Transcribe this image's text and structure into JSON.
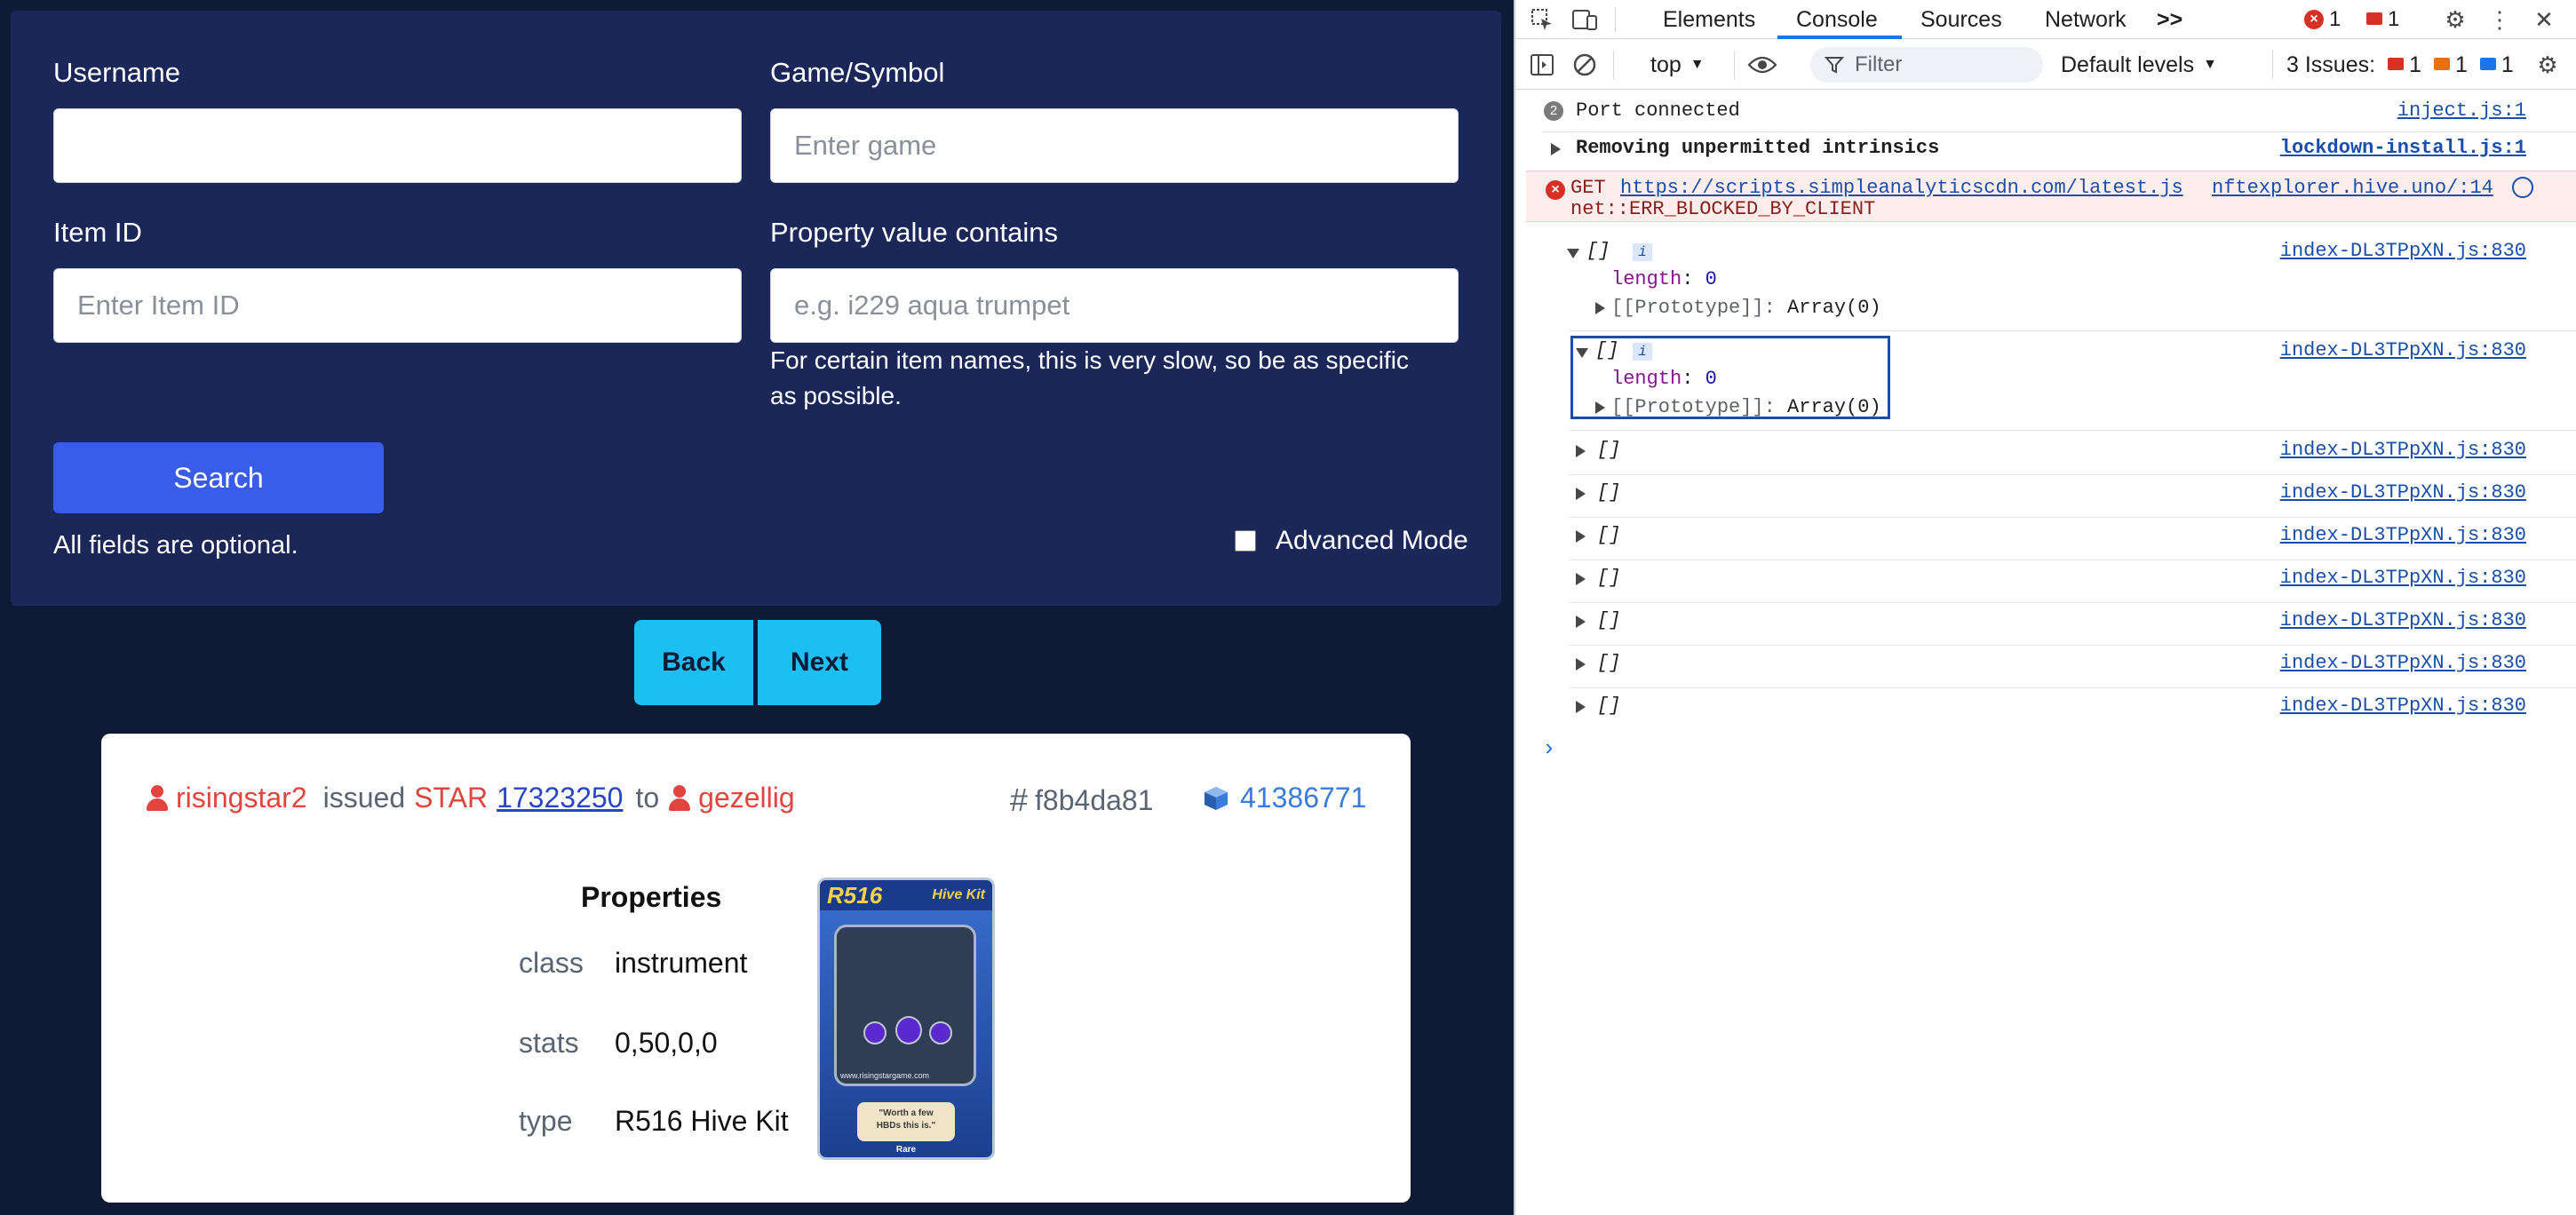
{
  "form": {
    "username_label": "Username",
    "username_value": "",
    "game_label": "Game/Symbol",
    "game_placeholder": "Enter game",
    "item_id_label": "Item ID",
    "item_id_placeholder": "Enter Item ID",
    "property_label": "Property value contains",
    "property_placeholder": "e.g. i229 aqua trumpet",
    "property_help_line1": "For certain item names, this is very slow, so be as specific",
    "property_help_line2": "as possible.",
    "search_button": "Search",
    "optional_note": "All fields are optional.",
    "advanced_label": "Advanced Mode",
    "advanced_checked": false
  },
  "pager": {
    "back": "Back",
    "next": "Next"
  },
  "card": {
    "issuer": "risingstar2",
    "verb": "issued",
    "token": "STAR",
    "amount": "17323250",
    "to_word": "to",
    "recipient": "gezellig",
    "hash_symbol": "#",
    "hash": "f8b4da81",
    "block_icon": "cube-icon",
    "block": "41386771",
    "properties_title": "Properties",
    "properties": [
      {
        "key": "class",
        "value": "instrument"
      },
      {
        "key": "stats",
        "value": "0,50,0,0"
      },
      {
        "key": "type",
        "value": "R516 Hive Kit"
      }
    ],
    "nft_card": {
      "code": "R516",
      "name": "Hive Kit",
      "site": "www.risingstargame.com",
      "quote_line1": "\"Worth a few",
      "quote_line2": "HBDs this is.\"",
      "rarity": "Rare"
    }
  },
  "devtools": {
    "tabs": [
      "Elements",
      "Console",
      "Sources",
      "Network"
    ],
    "active_tab": "Console",
    "more_tabs": ">>",
    "error_count": "1",
    "issue_flag_count": "1",
    "context": "top",
    "filter_placeholder": "Filter",
    "levels": "Default levels",
    "issues_label": "3 Issues:",
    "issues_red": "1",
    "issues_orange": "1",
    "issues_blue": "1",
    "colors": {
      "accent": "#1a73e8",
      "error": "#d93025",
      "warning": "#e8710a",
      "link": "#1a4ea8"
    },
    "logs": {
      "port": {
        "count": "2",
        "text": "Port connected",
        "src": "inject.js:1"
      },
      "lockdown": {
        "text": "Removing unpermitted intrinsics",
        "src": "lockdown-install.js:1"
      },
      "error": {
        "method": "GET",
        "url": "https://scripts.simpleanalyticscdn.com/latest.js",
        "src": "nftexplorer.hive.uno/:14",
        "detail": "net::ERR_BLOCKED_BY_CLIENT"
      },
      "array_label": "[]",
      "info_badge": "i",
      "length_key": "length",
      "length_val": "0",
      "proto_key": "[[Prototype]]",
      "proto_val": "Array(0)",
      "array_src": "index-DL3TPpXN.js:830"
    }
  }
}
